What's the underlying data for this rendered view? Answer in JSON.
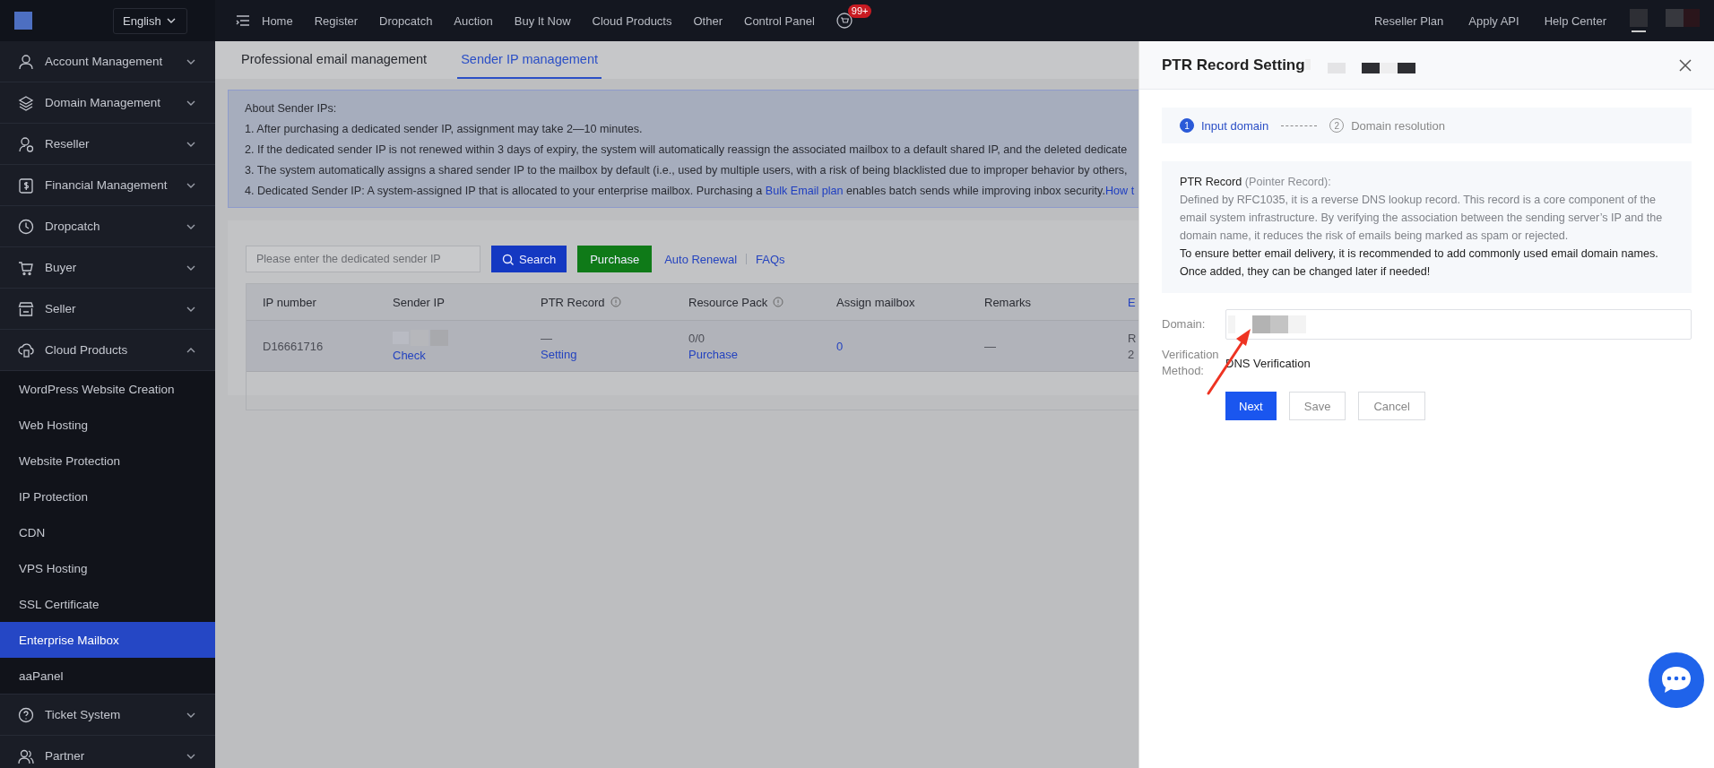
{
  "top_bar": {
    "language": "English",
    "nav": [
      "Home",
      "Register",
      "Dropcatch",
      "Auction",
      "Buy It Now",
      "Cloud Products",
      "Other",
      "Control Panel"
    ],
    "badge": "99+",
    "right_links": [
      "Reseller Plan",
      "Apply API",
      "Help Center"
    ]
  },
  "sidebar": {
    "items": [
      {
        "label": "Account Management",
        "expanded": false
      },
      {
        "label": "Domain Management",
        "expanded": false
      },
      {
        "label": "Reseller",
        "expanded": false
      },
      {
        "label": "Financial Management",
        "expanded": false
      },
      {
        "label": "Dropcatch",
        "expanded": false
      },
      {
        "label": "Buyer",
        "expanded": false
      },
      {
        "label": "Seller",
        "expanded": false
      },
      {
        "label": "Cloud Products",
        "expanded": true,
        "children": [
          {
            "label": "WordPress Website Creation",
            "selected": false
          },
          {
            "label": "Web Hosting",
            "selected": false
          },
          {
            "label": "Website Protection",
            "selected": false
          },
          {
            "label": "IP Protection",
            "selected": false
          },
          {
            "label": "CDN",
            "selected": false
          },
          {
            "label": "VPS Hosting",
            "selected": false
          },
          {
            "label": "SSL Certificate",
            "selected": false
          },
          {
            "label": "Enterprise Mailbox",
            "selected": true
          },
          {
            "label": "aaPanel",
            "selected": false
          }
        ]
      },
      {
        "label": "Ticket System",
        "expanded": false
      },
      {
        "label": "Partner",
        "expanded": false
      }
    ]
  },
  "tabs": [
    {
      "label": "Professional email management",
      "selected": false
    },
    {
      "label": "Sender IP management",
      "selected": true
    }
  ],
  "notice": {
    "title": "About Sender IPs:",
    "lines": [
      [
        {
          "text": "1. After purchasing a dedicated sender IP, assignment may take 2—10 minutes.",
          "link": false
        }
      ],
      [
        {
          "text": "2. If the dedicated sender IP is not renewed within 3 days of expiry, the system will automatically reassign the associated mailbox to a default shared IP, and the deleted dedicate",
          "link": false
        }
      ],
      [
        {
          "text": "3. The system automatically assigns a shared sender IP to the mailbox by default (i.e., used by multiple users, with a risk of being blacklisted due to improper behavior by others,",
          "link": false
        }
      ],
      [
        {
          "text": "4. Dedicated Sender IP: A system-assigned IP that is allocated to your enterprise mailbox. Purchasing a ",
          "link": false
        },
        {
          "text": "Bulk Email plan",
          "link": true
        },
        {
          "text": " enables batch sends while improving inbox security.",
          "link": false
        },
        {
          "text": "How t",
          "link": true
        }
      ]
    ]
  },
  "toolbar": {
    "search_placeholder": "Please enter the dedicated sender IP",
    "search_button": "Search",
    "purchase_button": "Purchase",
    "links": [
      "Auto Renewal",
      "FAQs"
    ]
  },
  "table": {
    "columns": [
      {
        "label": "IP number",
        "info": false
      },
      {
        "label": "Sender IP",
        "info": false
      },
      {
        "label": "PTR Record",
        "info": true
      },
      {
        "label": "Resource Pack",
        "info": true
      },
      {
        "label": "Assign mailbox",
        "info": false
      },
      {
        "label": "Remarks",
        "info": false
      },
      {
        "label": "E",
        "info": false,
        "link": true
      }
    ],
    "rows": [
      [
        [
          {
            "text": "D16661716",
            "link": false
          }
        ],
        [
          {
            "kind": "redacted"
          },
          {
            "text": "Check",
            "link": true
          }
        ],
        [
          {
            "text": "—",
            "link": false
          },
          {
            "text": "Setting",
            "link": true
          }
        ],
        [
          {
            "text": "0/0",
            "link": false
          },
          {
            "text": "Purchase",
            "link": true
          }
        ],
        [
          {
            "text": "0",
            "link": true
          }
        ],
        [
          {
            "text": "—",
            "link": false
          }
        ],
        [
          {
            "text": "R",
            "link": false
          },
          {
            "text": "2",
            "link": false
          }
        ]
      ]
    ]
  },
  "drawer": {
    "title": "PTR Record Setting",
    "steps": [
      {
        "number": "1",
        "label": "Input domain",
        "selected": true
      },
      {
        "number": "2",
        "label": "Domain resolution",
        "selected": false
      }
    ],
    "info": {
      "heading": "PTR Record",
      "heading_note": "(Pointer Record):",
      "description": "Defined by RFC1035, it is a reverse DNS lookup record. This record is a core component of the email system infrastructure. By verifying the association between the sending server’s IP and the domain name, it reduces the risk of emails being marked as spam or rejected.",
      "advice": [
        "To ensure better email delivery, it is recommended to add commonly used email domain names.",
        "Once added, they can be changed later if needed!"
      ]
    },
    "domain_label": "Domain:",
    "method_label": "Verification Method:",
    "method_value": "DNS Verification",
    "buttons": [
      {
        "label": "Next",
        "kind": "primary"
      },
      {
        "label": "Save",
        "kind": "default"
      },
      {
        "label": "Cancel",
        "kind": "default"
      }
    ]
  }
}
